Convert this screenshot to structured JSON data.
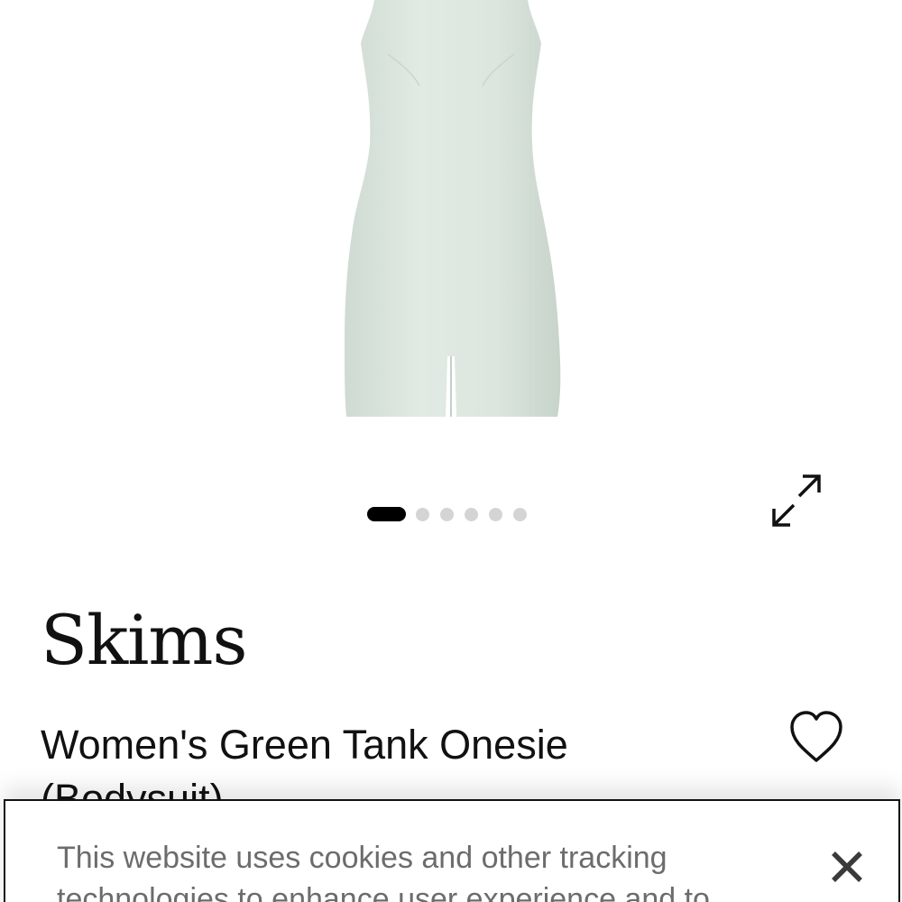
{
  "product": {
    "brand": "Skims",
    "name": "Women's Green Tank Onesie (Bodysuit)",
    "garment_color": "#dde7df"
  },
  "gallery": {
    "image_count": 6,
    "active_index": 0,
    "expand_icon": "expand-arrows-icon"
  },
  "wishlist": {
    "icon": "heart-outline-icon"
  },
  "cookie_banner": {
    "text": "This website uses cookies and other tracking technologies to enhance user experience and to",
    "close_icon": "close-x-icon"
  }
}
